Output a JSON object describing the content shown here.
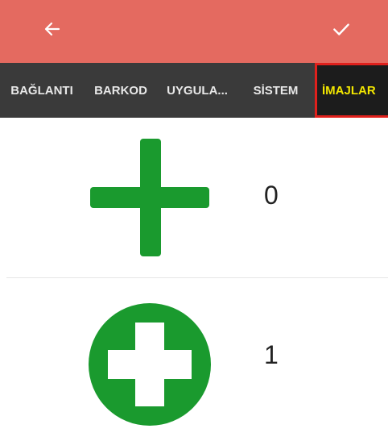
{
  "colors": {
    "toolbar": "#E46A60",
    "tab_bar": "#3A3A3A",
    "active_tab_text": "#F2E600",
    "active_tab_border": "#E0201C",
    "icon_green": "#1A9A2E"
  },
  "toolbar": {
    "back_icon": "arrow-left-icon",
    "confirm_icon": "check-icon"
  },
  "tabs": [
    {
      "label": "BAĞLANTI",
      "active": false
    },
    {
      "label": "BARKOD",
      "active": false
    },
    {
      "label": "UYGULA...",
      "active": false
    },
    {
      "label": "SİSTEM",
      "active": false
    },
    {
      "label": "İMAJLAR",
      "active": true
    }
  ],
  "images": [
    {
      "icon": "plus-icon",
      "value": "0"
    },
    {
      "icon": "plus-circle-icon",
      "value": "1"
    }
  ]
}
